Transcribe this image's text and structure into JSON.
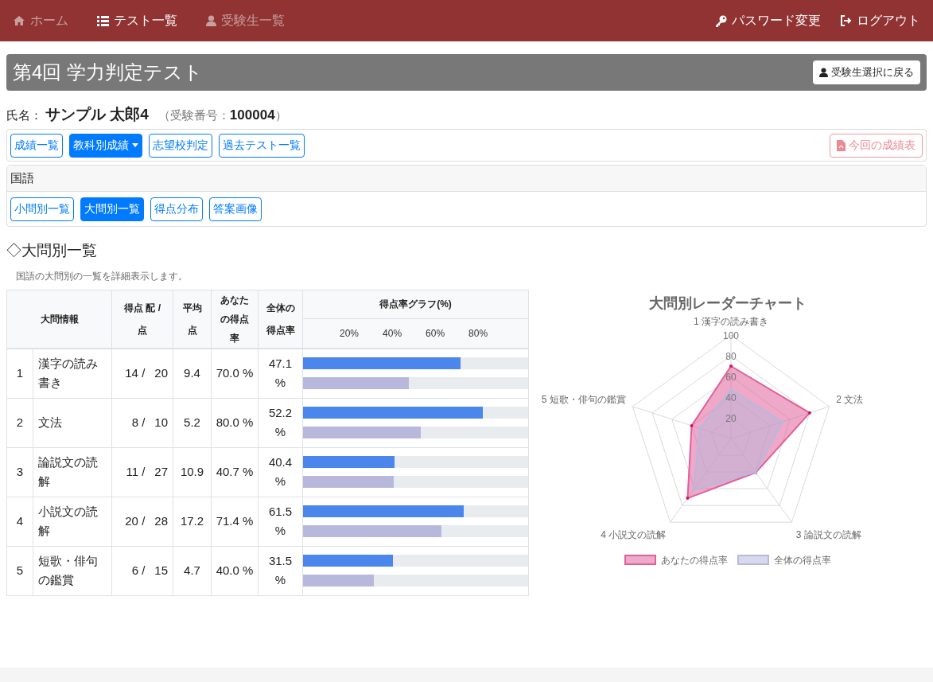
{
  "navbar": {
    "left": [
      {
        "label": "ホーム",
        "selected": false
      },
      {
        "label": "テスト一覧",
        "selected": true
      },
      {
        "label": "受験生一覧",
        "selected": false
      }
    ],
    "right": [
      {
        "label": "パスワード変更"
      },
      {
        "label": "ログアウト"
      }
    ]
  },
  "title_bar": {
    "title": "第4回 学力判定テスト",
    "back_button": "受験生選択に戻る"
  },
  "student": {
    "name_label": "氏名：",
    "name": "サンプル 太郎4",
    "number_label": "（受験番号：",
    "number": "100004",
    "number_close": "）"
  },
  "toolbar": {
    "buttons": [
      {
        "label": "成績一覧",
        "selected": false,
        "dropdown": false
      },
      {
        "label": "教科別成績",
        "selected": true,
        "dropdown": true
      },
      {
        "label": "志望校判定",
        "selected": false,
        "dropdown": false
      },
      {
        "label": "過去テスト一覧",
        "selected": false,
        "dropdown": false
      }
    ],
    "report_button": "今回の成績表"
  },
  "subject_panel": {
    "subject": "国語",
    "tabs": [
      {
        "label": "小問別一覧",
        "selected": false
      },
      {
        "label": "大問別一覧",
        "selected": true
      },
      {
        "label": "得点分布",
        "selected": false
      },
      {
        "label": "答案画像",
        "selected": false
      }
    ]
  },
  "section": {
    "heading": "◇大問別一覧",
    "description": "国語の大問別の一覧を詳細表示します。"
  },
  "table": {
    "columns": [
      "大問情報",
      "得点 配 / 点",
      "平均点",
      "あなたの得点率",
      "全体の得点率",
      "得点率グラフ(%)"
    ],
    "axis_ticks": [
      "20%",
      "40%",
      "60%",
      "80%"
    ],
    "rows": [
      {
        "no": "1",
        "name": "漢字の読み書き",
        "score": "14 /",
        "max": "20",
        "average": "9.4",
        "your_rate": "70.0 %",
        "overall_rate": "47.1 %",
        "your_bar": {
          "level": 0.7
        },
        "overall_bar": {
          "level": 0.471
        }
      },
      {
        "no": "2",
        "name": "文法",
        "score": "8 /",
        "max": "10",
        "average": "5.2",
        "your_rate": "80.0 %",
        "overall_rate": "52.2 %",
        "your_bar": {
          "level": 0.8
        },
        "overall_bar": {
          "level": 0.522
        }
      },
      {
        "no": "3",
        "name": "論説文の読解",
        "score": "11 /",
        "max": "27",
        "average": "10.9",
        "your_rate": "40.7 %",
        "overall_rate": "40.4 %",
        "your_bar": {
          "level": 0.407
        },
        "overall_bar": {
          "level": 0.404
        }
      },
      {
        "no": "4",
        "name": "小説文の読解",
        "score": "20 /",
        "max": "28",
        "average": "17.2",
        "your_rate": "71.4 %",
        "overall_rate": "61.5 %",
        "your_bar": {
          "level": 0.714
        },
        "overall_bar": {
          "level": 0.615
        }
      },
      {
        "no": "5",
        "name": "短歌・俳句の鑑賞",
        "score": "6 /",
        "max": "15",
        "average": "4.7",
        "your_rate": "40.0 %",
        "overall_rate": "31.5 %",
        "your_bar": {
          "level": 0.4
        },
        "overall_bar": {
          "level": 0.315
        }
      }
    ]
  },
  "radar": {
    "title": "大問別レーダーチャート",
    "axis_labels": [
      "1 漢字の読み書き",
      "5 短歌・俳句の鑑賞",
      "2 文法",
      "4 小説文の読解",
      "3 論説文の読解"
    ],
    "ticks": [
      "100",
      "80",
      "60",
      "40",
      "20"
    ],
    "series": [
      {
        "name": "あなたの得点率",
        "color": "#e0609a"
      },
      {
        "name": "全体の得点率",
        "color": "#b8b8dc"
      }
    ]
  }
}
